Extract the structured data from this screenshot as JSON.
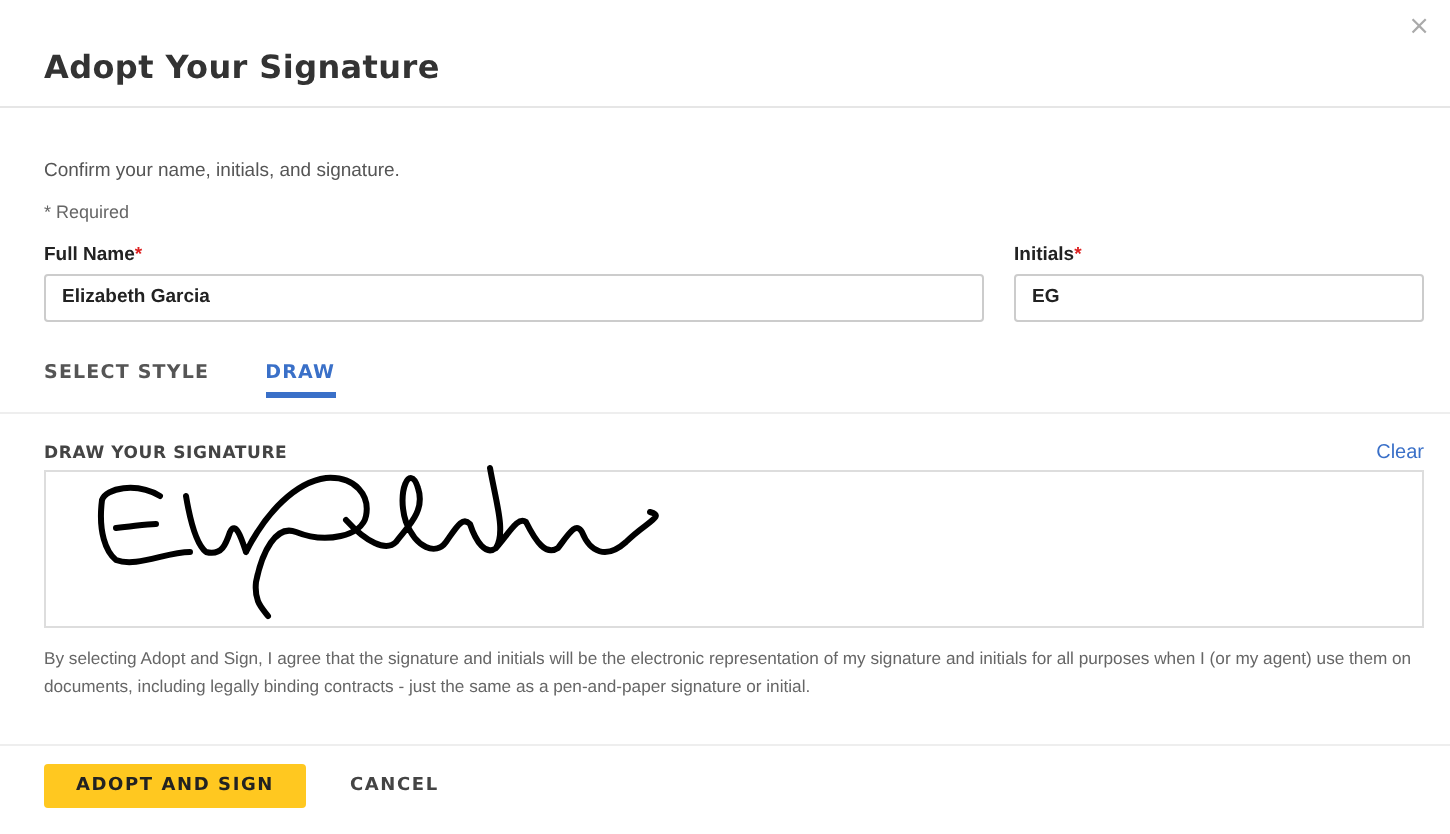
{
  "dialog": {
    "title": "Adopt Your Signature",
    "close": "×"
  },
  "intro": "Confirm your name, initials, and signature.",
  "required_note": "* Required",
  "fields": [
    {
      "label": "Full Name",
      "required_mark": "*",
      "value": "Elizabeth Garcia"
    },
    {
      "label": "Initials",
      "required_mark": "*",
      "value": "EG"
    }
  ],
  "tabs": [
    {
      "label": "SELECT STYLE",
      "selected": false
    },
    {
      "label": "DRAW",
      "selected": true
    }
  ],
  "signature_pad": {
    "label": "DRAW YOUR SIGNATURE",
    "clear": "Clear"
  },
  "disclaimer": "By selecting Adopt and Sign, I agree that the signature and initials will be the electronic representation of my signature and initials for all purposes when I (or my agent) use them on documents, including legally binding contracts - just the same as a pen-and-paper signature or initial.",
  "buttons": [
    {
      "label": "ADOPT AND SIGN",
      "kind": "primary"
    },
    {
      "label": "CANCEL",
      "kind": "secondary"
    }
  ]
}
